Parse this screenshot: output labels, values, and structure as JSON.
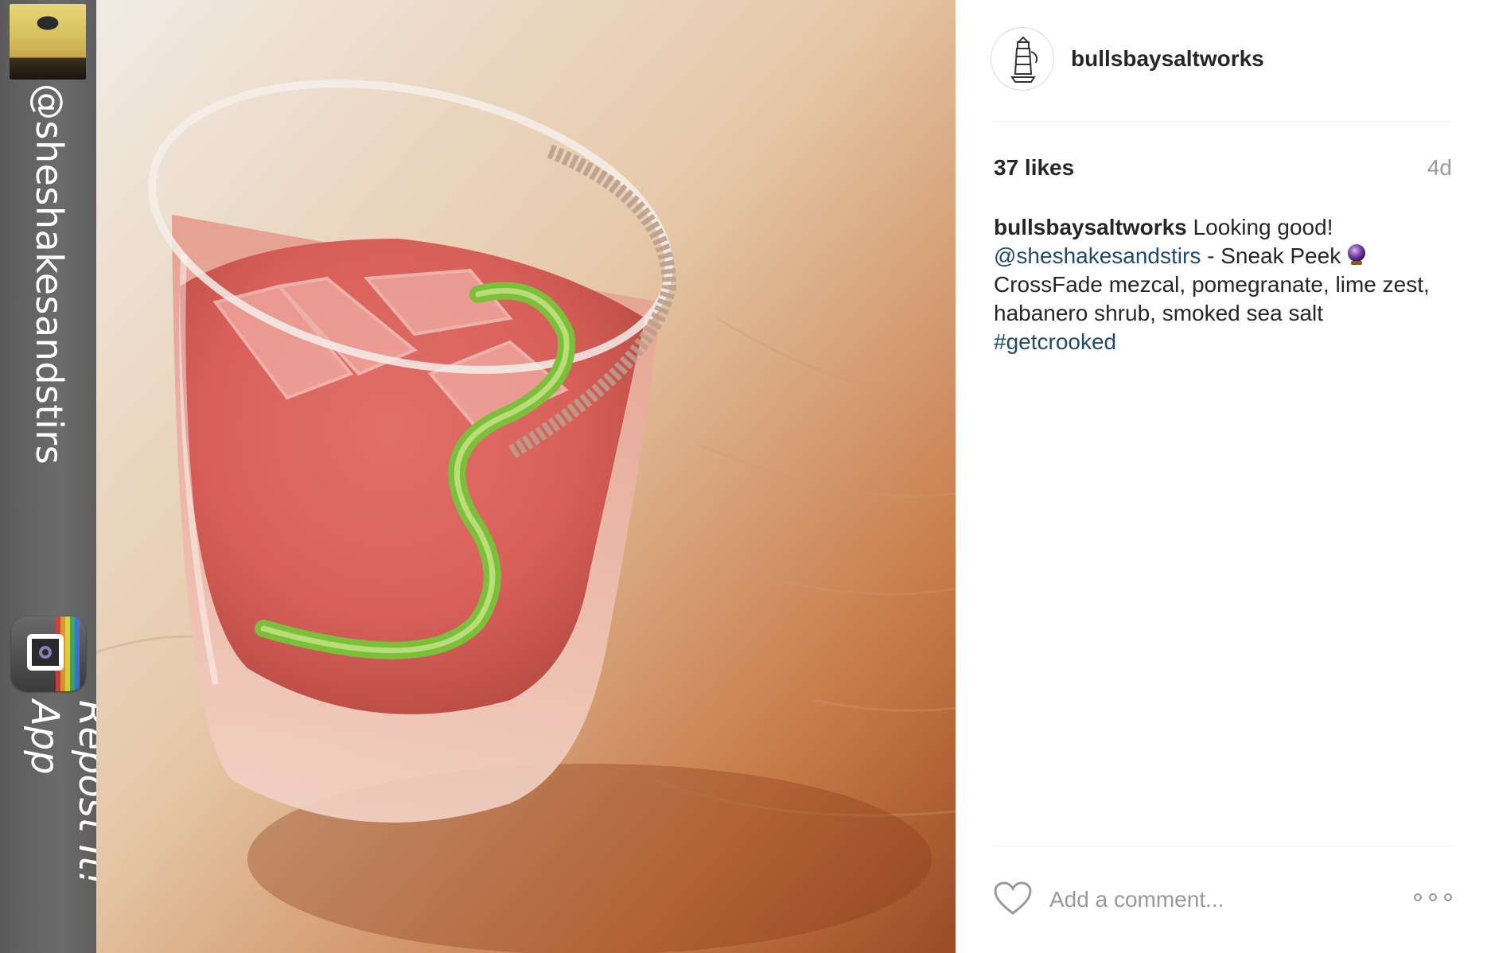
{
  "repost": {
    "handle": "@sheshakesandstirs",
    "app_label": "Repost It! App",
    "avatar_icon": "user-avatar",
    "app_icon": "repost-app-icon"
  },
  "photo": {
    "alt": "cocktail glass with salted rim and lime twist"
  },
  "post": {
    "username": "bullsbaysaltworks",
    "profile_icon": "lighthouse-logo-icon",
    "likes": "37 likes",
    "time": "4d",
    "caption": {
      "user": "bullsbaysaltworks",
      "text1": " Looking good!",
      "mention": "@sheshakesandstirs",
      "text2": " - Sneak Peek",
      "line3": "CrossFade mezcal, pomegranate, lime zest,",
      "line4": "habanero shrub, smoked sea salt",
      "hashtag": "#getcrooked",
      "emoji_icon": "crystal-ball-icon"
    },
    "comment_placeholder": "Add a comment...",
    "like_icon": "heart-icon",
    "more_icon": "more-options-icon"
  },
  "colors": {
    "link": "#1f4a6e",
    "muted": "#999999",
    "text": "#262626"
  }
}
